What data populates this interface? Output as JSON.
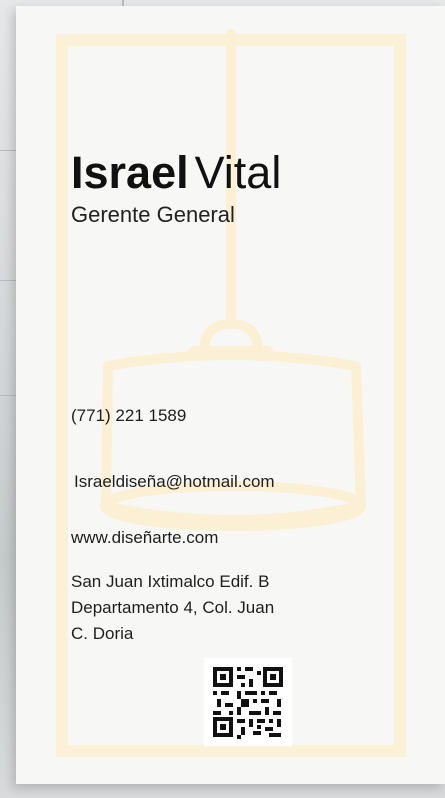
{
  "card": {
    "first_name": "Israel",
    "last_name": "Vital",
    "role": "Gerente General",
    "phone": "(771) 221 1589",
    "email": "Israeldiseña@hotmail.com",
    "website": "www.diseñarte.com",
    "address_line1": "San Juan Ixtimalco Edif. B",
    "address_line2": "Departamento 4, Col. Juan",
    "address_line3": "C. Doria"
  },
  "colors": {
    "card_background": "#f7f7f6",
    "accent_frame": "#fbf1d6",
    "text": "#111111"
  },
  "icons": [
    "lamp-illustration",
    "qr-code-icon"
  ]
}
